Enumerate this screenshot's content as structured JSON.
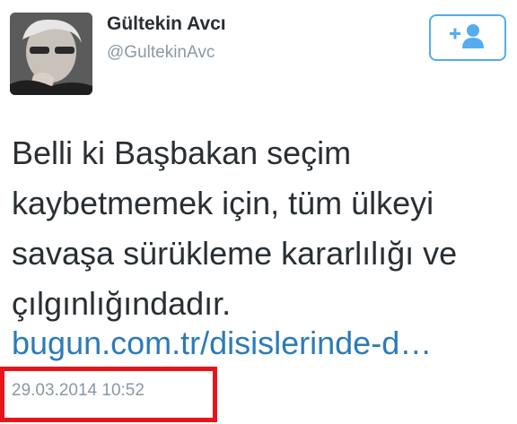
{
  "user": {
    "display_name": "Gültekin Avcı",
    "screen_name": "@GultekinAvc"
  },
  "follow_button": {
    "icon": "add-user-icon",
    "color": "#55acee"
  },
  "tweet": {
    "text": "Belli ki Başbakan seçim kaybetmemek için, tüm ülkeyi savaşa sürükleme kararlılığı ve çılgınlığındadır.",
    "link_text": "bugun.com.tr/disislerinde-d…",
    "timestamp": "29.03.2014 10:52"
  },
  "colors": {
    "text": "#292f33",
    "muted": "#8899a6",
    "link": "#2b7bb9",
    "highlight": "#e8141c"
  }
}
